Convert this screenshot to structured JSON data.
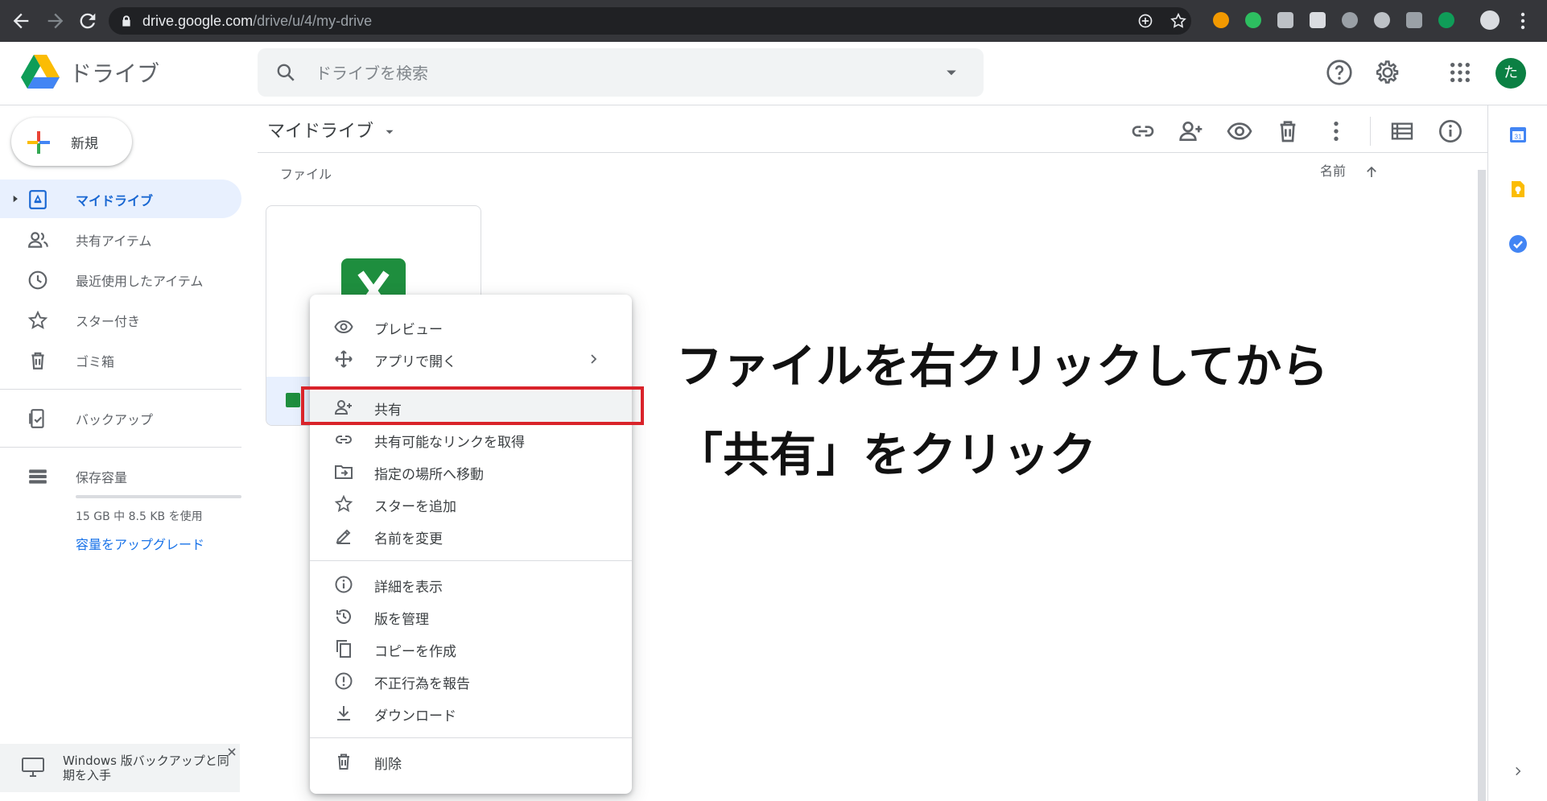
{
  "browser": {
    "url_host": "drive.google.com",
    "url_path": "/drive/u/4/my-drive"
  },
  "header": {
    "app_title": "ドライブ",
    "search_placeholder": "ドライブを検索",
    "avatar_initial": "た"
  },
  "sidebar": {
    "new_label": "新規",
    "items": [
      {
        "label": "マイドライブ",
        "icon": "my-drive-icon",
        "active": true
      },
      {
        "label": "共有アイテム",
        "icon": "shared-icon"
      },
      {
        "label": "最近使用したアイテム",
        "icon": "clock-icon"
      },
      {
        "label": "スター付き",
        "icon": "star-icon"
      },
      {
        "label": "ゴミ箱",
        "icon": "trash-icon"
      },
      {
        "label": "バックアップ",
        "icon": "backup-icon"
      },
      {
        "label": "保存容量",
        "icon": "storage-icon"
      }
    ],
    "storage_used": "15 GB 中 8.5 KB を使用",
    "upgrade_link": "容量をアップグレード",
    "backup_promo": "Windows 版バックアップと同期を入手"
  },
  "main": {
    "breadcrumb": "マイドライブ",
    "files_heading": "ファイル",
    "sort_label": "名前"
  },
  "context_menu": {
    "items": [
      {
        "label": "プレビュー",
        "icon": "eye-icon"
      },
      {
        "label": "アプリで開く",
        "icon": "move-arrows-icon",
        "submenu": true
      },
      {
        "label": "共有",
        "icon": "add-person-icon",
        "highlighted": true
      },
      {
        "label": "共有可能なリンクを取得",
        "icon": "link-icon"
      },
      {
        "label": "指定の場所へ移動",
        "icon": "move-to-folder-icon"
      },
      {
        "label": "スターを追加",
        "icon": "star-icon"
      },
      {
        "label": "名前を変更",
        "icon": "pencil-icon"
      },
      {
        "label": "詳細を表示",
        "icon": "info-icon"
      },
      {
        "label": "版を管理",
        "icon": "history-icon"
      },
      {
        "label": "コピーを作成",
        "icon": "copy-icon"
      },
      {
        "label": "不正行為を報告",
        "icon": "alert-icon"
      },
      {
        "label": "ダウンロード",
        "icon": "download-icon"
      },
      {
        "label": "削除",
        "icon": "trash-icon"
      }
    ]
  },
  "annotation": {
    "line1": "ファイルを右クリックしてから",
    "line2": "「共有」をクリック"
  },
  "colors": {
    "accent": "#1a73e8",
    "highlight_box": "#d9232a",
    "sheets_green": "#1e8e3e"
  }
}
